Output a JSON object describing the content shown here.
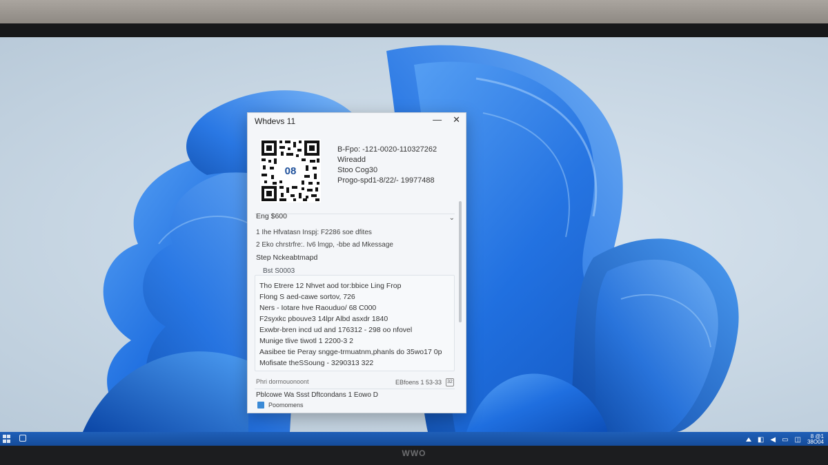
{
  "window": {
    "title": "Whdevs 11",
    "minimize_glyph": "—",
    "close_glyph": "✕"
  },
  "qr": {
    "center_label": "08"
  },
  "info": {
    "line1": "B-Fpo: -121-0020-110327262",
    "line2": "Wireadd",
    "line3": "Stoo Cog30",
    "line4": "Progo-spd1-8/22/- 19977488"
  },
  "section": {
    "header": "Eng $600",
    "item1": "1 Ihe Hfvatasn Inspj: F2286 soe dfites",
    "item2": "2 Eko chrstrfre:. Iv6 lmgp, -bbe ad Mkessage",
    "item3": "Step Nckeabtmapd"
  },
  "panel": {
    "header": "Bst S0003",
    "lines": [
      "Tho Etrere 12 Nhvet aod tor:bbice Ling Frop",
      "Flong S aed-cawe sortov, 726",
      "Ners - Iotare hve Raouduo/ 68 C000",
      "F2syxkc pbouve3 14lpr Albd asxdr 1840",
      "Exwbr-bren incd ud and 176312 - 298 oo nfovel",
      "Munige tlive tiwotl 1 2200-3 2",
      "Aasibee tie Peray sngge-trmuatnm,phanls do 35wo17 0p",
      "Mofisate theSSoung - 3290313 322"
    ]
  },
  "footer": {
    "left_text": "Phri dormouonoont",
    "right_text": "EBfoens 1 53-33",
    "right_badge": "32",
    "line": "Pblcowe Wa Ssst Dftcondans 1 Eowo D",
    "checkbox_label": "Poomomens"
  },
  "taskbar": {
    "time": "8 @1",
    "date": "38O04"
  },
  "monitor": {
    "brand": "WWO"
  },
  "colors": {
    "accent": "#1a6fd6",
    "taskbar": "#1a58ad",
    "bloom": "#2f7fe6"
  }
}
